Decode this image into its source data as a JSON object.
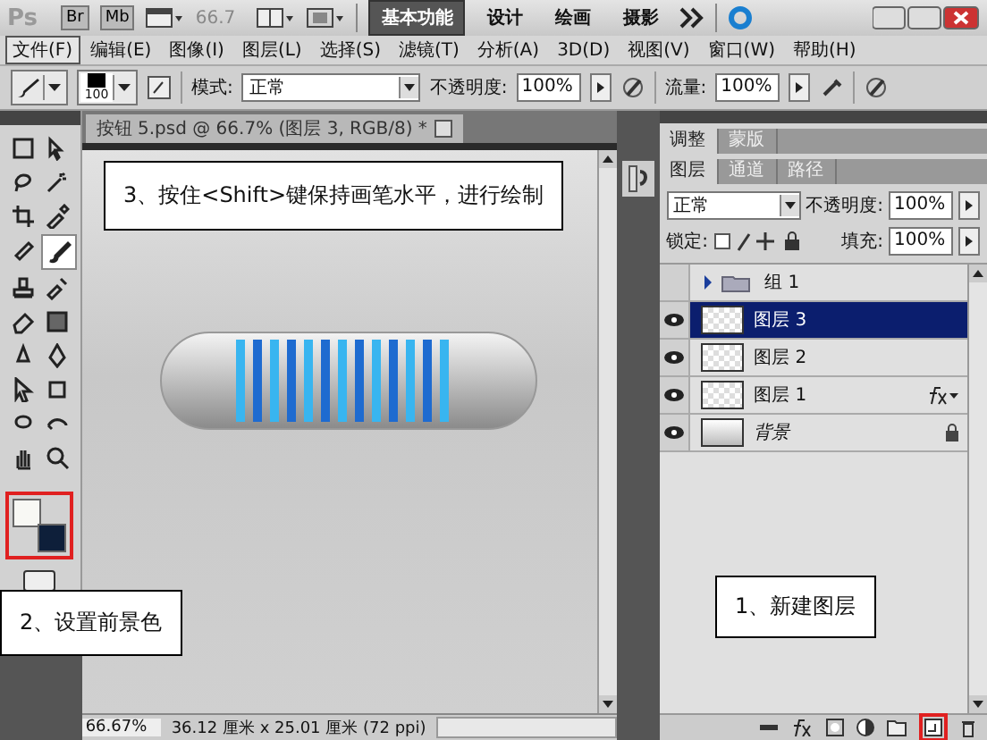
{
  "app_bar": {
    "logo": "Ps",
    "bridge": "Br",
    "mini_bridge": "Mb",
    "zoom": "66.7",
    "workspaces": [
      {
        "label": "基本功能",
        "selected": true
      },
      {
        "label": "设计",
        "selected": false
      },
      {
        "label": "绘画",
        "selected": false
      },
      {
        "label": "摄影",
        "selected": false
      }
    ]
  },
  "menu": [
    {
      "label": "文件(F)",
      "selected": true
    },
    {
      "label": "编辑(E)",
      "selected": false
    },
    {
      "label": "图像(I)",
      "selected": false
    },
    {
      "label": "图层(L)",
      "selected": false
    },
    {
      "label": "选择(S)",
      "selected": false
    },
    {
      "label": "滤镜(T)",
      "selected": false
    },
    {
      "label": "分析(A)",
      "selected": false
    },
    {
      "label": "3D(D)",
      "selected": false
    },
    {
      "label": "视图(V)",
      "selected": false
    },
    {
      "label": "窗口(W)",
      "selected": false
    },
    {
      "label": "帮助(H)",
      "selected": false
    }
  ],
  "options_bar": {
    "brush_size": "100",
    "mode_label": "模式:",
    "mode": "正常",
    "opacity_label": "不透明度:",
    "opacity": "100%",
    "flow_label": "流量:",
    "flow": "100%"
  },
  "tools": [
    {
      "kind": "marquee",
      "selected": false
    },
    {
      "kind": "move",
      "selected": false
    },
    {
      "kind": "lasso",
      "selected": false
    },
    {
      "kind": "wand",
      "selected": false
    },
    {
      "kind": "crop",
      "selected": false
    },
    {
      "kind": "eyedropper",
      "selected": false
    },
    {
      "kind": "healing",
      "selected": false
    },
    {
      "kind": "brush",
      "selected": true
    },
    {
      "kind": "stamp",
      "selected": false
    },
    {
      "kind": "history",
      "selected": false
    },
    {
      "kind": "eraser",
      "selected": false
    },
    {
      "kind": "gradient",
      "selected": false
    },
    {
      "kind": "dodge",
      "selected": false
    },
    {
      "kind": "pen",
      "selected": false
    },
    {
      "kind": "select",
      "selected": false
    },
    {
      "kind": "shape",
      "selected": false
    },
    {
      "kind": "rotate",
      "selected": false
    },
    {
      "kind": "orbit",
      "selected": false
    },
    {
      "kind": "hand",
      "selected": false
    },
    {
      "kind": "zoom",
      "selected": false
    }
  ],
  "colors": {
    "highlighted": true
  },
  "document": {
    "tab": "按钮 5.psd @ 66.7% (图层 3, RGB/8) *",
    "status_zoom": "66.67%",
    "status_info": "36.12 厘米 x 25.01 厘米 (72 ppi)"
  },
  "panel": {
    "top_tabs": [
      {
        "label": "调整",
        "selected": true
      },
      {
        "label": "蒙版",
        "selected": false
      }
    ],
    "layer_tabs": [
      {
        "label": "图层",
        "selected": true
      },
      {
        "label": "通道",
        "selected": false
      },
      {
        "label": "路径",
        "selected": false
      }
    ],
    "blend_mode": "正常",
    "opacity_label": "不透明度:",
    "opacity": "100%",
    "lock_label": "锁定:",
    "fill_label": "填充:",
    "fill": "100%",
    "layers": [
      {
        "kind": "group",
        "name": "组 1",
        "visible": false,
        "selected": false,
        "fx": false,
        "locked": false
      },
      {
        "kind": "layer",
        "name": "图层 3",
        "visible": true,
        "selected": true,
        "fx": false,
        "locked": false
      },
      {
        "kind": "layer",
        "name": "图层 2",
        "visible": true,
        "selected": false,
        "fx": false,
        "locked": false
      },
      {
        "kind": "layer",
        "name": "图层 1",
        "visible": true,
        "selected": false,
        "fx": true,
        "locked": false
      },
      {
        "kind": "background",
        "name": "背景",
        "visible": true,
        "selected": false,
        "fx": false,
        "locked": true
      }
    ],
    "new_layer_highlighted": true
  },
  "callouts": [
    {
      "text": "3、按住<Shift>键保持画笔水平，进行绘制"
    },
    {
      "text": "2、设置前景色"
    },
    {
      "text": "1、新建图层"
    }
  ]
}
